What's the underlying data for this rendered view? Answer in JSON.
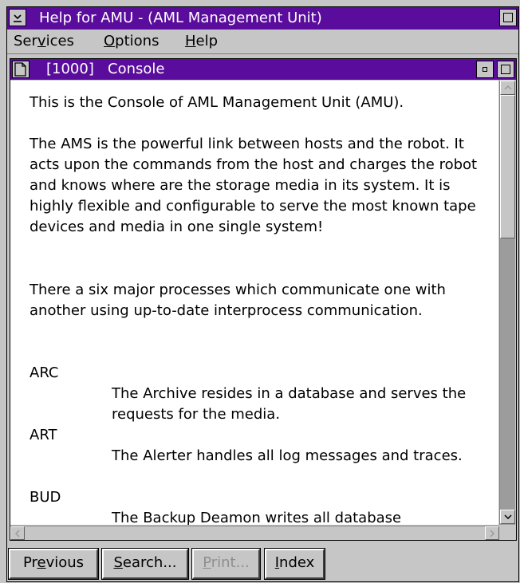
{
  "window": {
    "title": "Help for AMU - (AML Management Unit)"
  },
  "menubar": {
    "items": [
      {
        "pre": "Ser",
        "mn": "v",
        "post": "ices"
      },
      {
        "pre": "",
        "mn": "O",
        "post": "ptions"
      },
      {
        "pre": "",
        "mn": "H",
        "post": "elp"
      }
    ]
  },
  "console": {
    "title": "[1000]   Console",
    "paragraphs": [
      "This is the Console of AML Management Unit (AMU).",
      "The AMS is the powerful link between hosts and the robot. It acts upon the commands from the host and charges the robot and knows where are the storage media in its system. It is highly flexible and configurable to serve the most known tape devices and media in one single system!",
      "There a six major processes which communicate one with another using up-to-date interprocess communication."
    ],
    "terms": [
      {
        "term": "ARC",
        "def": "The Archive resides in a database and serves the requests for the media."
      },
      {
        "term": "ART",
        "def": "The Alerter handles all log messages and traces."
      },
      {
        "term": "BUD",
        "def": "The Backup Deamon writes all database"
      }
    ]
  },
  "buttons": {
    "previous": {
      "pre": "Pr",
      "mn": "e",
      "post": "vious"
    },
    "search": {
      "pre": "",
      "mn": "S",
      "post": "earch..."
    },
    "print": {
      "pre": "",
      "mn": "P",
      "post": "rint..."
    },
    "index": {
      "pre": "",
      "mn": "I",
      "post": "ndex"
    }
  },
  "colors": {
    "titlebar": "#5a0c9c",
    "chrome": "#c6c6c6"
  }
}
